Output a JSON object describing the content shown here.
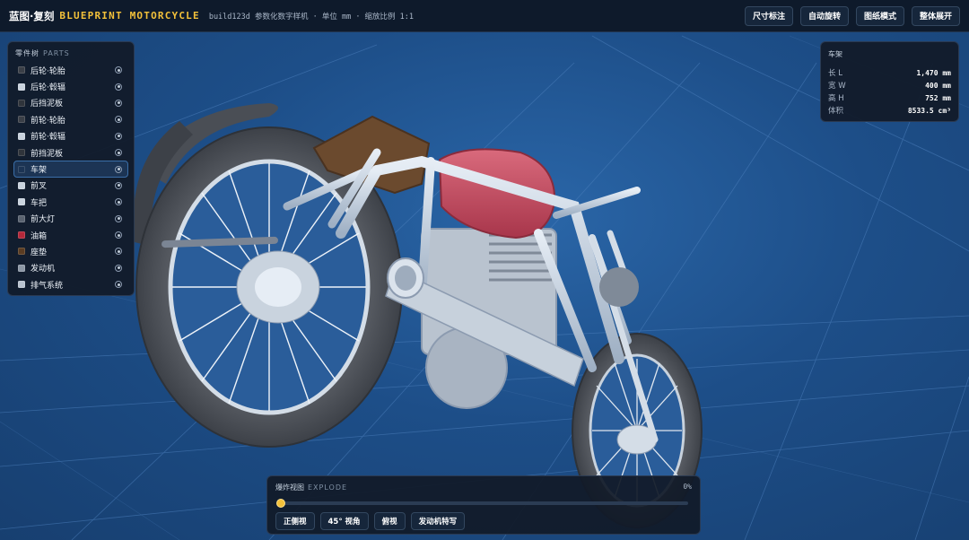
{
  "header": {
    "brand_cn": "蓝图·复刻",
    "brand_en": "BLUEPRINT MOTORCYCLE",
    "meta": "build123d 参数化数字样机 · 单位 mm · 缩放比例 1:1",
    "buttons": [
      "尺寸标注",
      "自动旋转",
      "图纸模式",
      "整体展开"
    ]
  },
  "parts_panel": {
    "title": "零件树",
    "subtitle": "PARTS",
    "items": [
      {
        "label": "后轮·轮胎",
        "color": "#3a3f47",
        "selected": false
      },
      {
        "label": "后轮·毂辐",
        "color": "#c9d3de",
        "selected": false
      },
      {
        "label": "后挡泥板",
        "color": "#2f343b",
        "selected": false
      },
      {
        "label": "前轮·轮胎",
        "color": "#3a3f47",
        "selected": false
      },
      {
        "label": "前轮·毂辐",
        "color": "#c9d3de",
        "selected": false
      },
      {
        "label": "前挡泥板",
        "color": "#2f343b",
        "selected": false
      },
      {
        "label": "车架",
        "color": "#1c3454",
        "selected": true
      },
      {
        "label": "前叉",
        "color": "#c9d3de",
        "selected": false
      },
      {
        "label": "车把",
        "color": "#c9d3de",
        "selected": false
      },
      {
        "label": "前大灯",
        "color": "#5a6370",
        "selected": false
      },
      {
        "label": "油箱",
        "color": "#b3283a",
        "selected": false
      },
      {
        "label": "座垫",
        "color": "#5a3c22",
        "selected": false
      },
      {
        "label": "发动机",
        "color": "#8d98a6",
        "selected": false
      },
      {
        "label": "排气系统",
        "color": "#b9c3cf",
        "selected": false
      }
    ]
  },
  "info_panel": {
    "title": "车架",
    "rows": [
      {
        "key": "长 L",
        "value": "1,470 mm"
      },
      {
        "key": "宽 W",
        "value": "400 mm"
      },
      {
        "key": "高 H",
        "value": "752 mm"
      },
      {
        "key": "体积",
        "value": "8533.5 cm³"
      }
    ]
  },
  "explode_panel": {
    "title": "爆炸视图",
    "subtitle": "EXPLODE",
    "percent_label": "0%",
    "value": 0,
    "views": [
      "正侧视",
      "45° 视角",
      "俯视",
      "发动机特写"
    ]
  },
  "colors": {
    "accent": "#f3c13a",
    "background": "#1f4f86",
    "panel": "#111a28",
    "frame": "#c9d6e6",
    "tank": "#c24a5e",
    "seat": "#6b4a2e"
  },
  "icons": {
    "visibility": "eye-icon",
    "slider_thumb": "slider-thumb"
  }
}
